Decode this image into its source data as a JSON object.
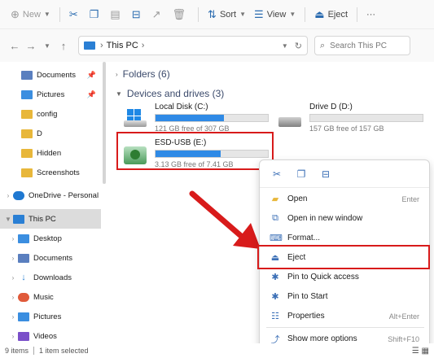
{
  "toolbar": {
    "new_label": "New",
    "sort_label": "Sort",
    "view_label": "View",
    "eject_label": "Eject",
    "more_label": "···"
  },
  "address": {
    "location": "This PC",
    "search_placeholder": "Search This PC"
  },
  "sidebar": {
    "items": [
      {
        "label": "Documents",
        "pinned": true
      },
      {
        "label": "Pictures",
        "pinned": true
      },
      {
        "label": "config"
      },
      {
        "label": "D"
      },
      {
        "label": "Hidden"
      },
      {
        "label": "Screenshots"
      },
      {
        "label": "OneDrive - Personal"
      },
      {
        "label": "This PC"
      },
      {
        "label": "Desktop"
      },
      {
        "label": "Documents"
      },
      {
        "label": "Downloads"
      },
      {
        "label": "Music"
      },
      {
        "label": "Pictures"
      },
      {
        "label": "Videos"
      }
    ]
  },
  "content": {
    "folders_header": "Folders (6)",
    "devices_header": "Devices and drives (3)",
    "drives": [
      {
        "name": "Local Disk (C:)",
        "free": "121 GB free of 307 GB",
        "used_fraction": 0.61
      },
      {
        "name": "Drive D (D:)",
        "free": "157 GB free of 157 GB",
        "used_fraction": 0.0
      },
      {
        "name": "ESD-USB (E:)",
        "free": "3.13 GB free of 7.41 GB",
        "used_fraction": 0.58
      }
    ]
  },
  "menu": {
    "items": [
      {
        "label": "Open",
        "shortcut": "Enter"
      },
      {
        "label": "Open in new window",
        "shortcut": ""
      },
      {
        "label": "Format...",
        "shortcut": ""
      },
      {
        "label": "Eject",
        "shortcut": ""
      },
      {
        "label": "Pin to Quick access",
        "shortcut": ""
      },
      {
        "label": "Pin to Start",
        "shortcut": ""
      },
      {
        "label": "Properties",
        "shortcut": "Alt+Enter"
      },
      {
        "label": "Show more options",
        "shortcut": "Shift+F10"
      }
    ]
  },
  "status": {
    "count": "9 items",
    "selected": "1 item selected"
  },
  "colors": {
    "accent": "#2f8ae6",
    "highlight": "#d81b1b"
  }
}
